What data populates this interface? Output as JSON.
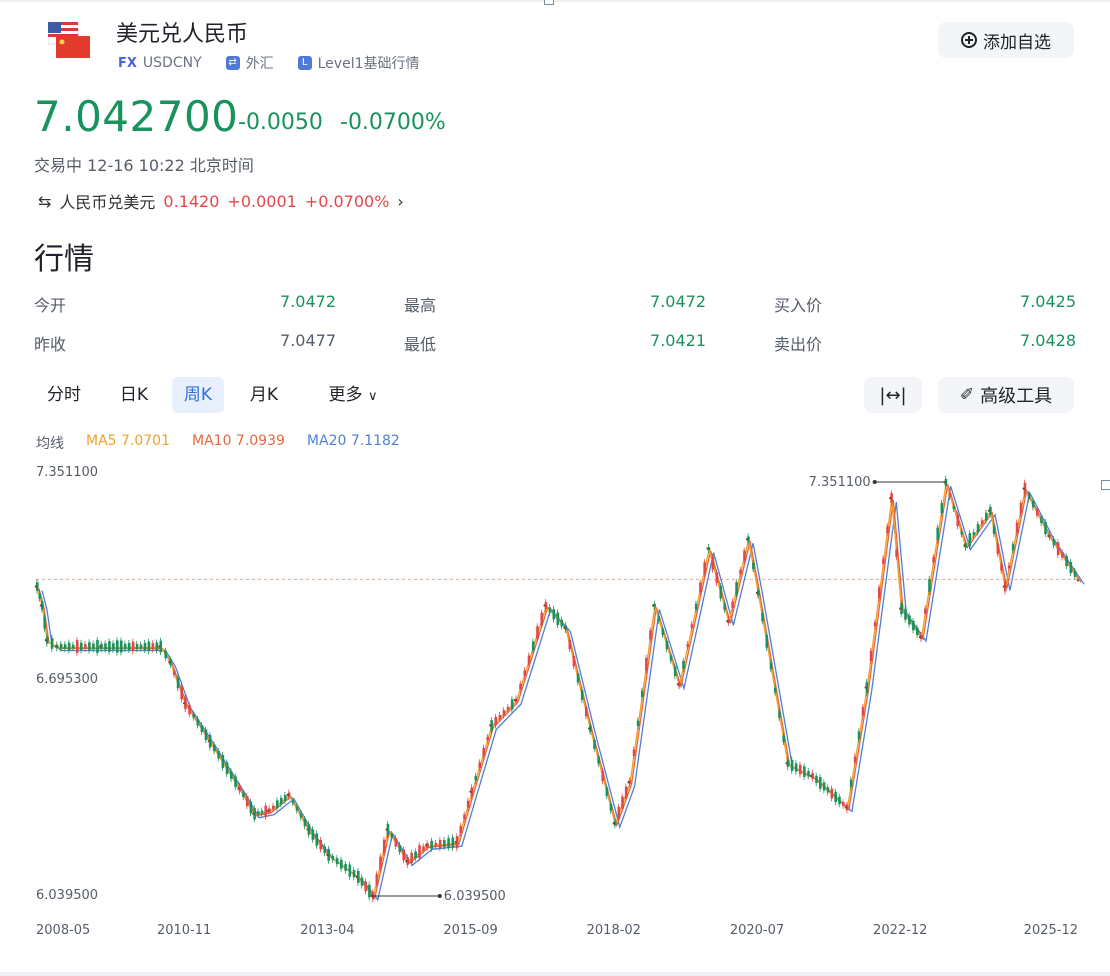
{
  "header": {
    "title": "美元兑人民币",
    "tag_fx": "FX",
    "symbol": "USDCNY",
    "tag_market": "外汇",
    "tag_level": "Level1基础行情",
    "add_watchlist_label": "添加自选"
  },
  "quote": {
    "price": "7.042700",
    "change": "-0.0050",
    "change_pct": "-0.0700%",
    "status": "交易中 12-16 10:22 北京时间",
    "reverse_label": "人民币兑美元",
    "reverse_price": "0.1420",
    "reverse_change": "+0.0001",
    "reverse_pct": "+0.0700%"
  },
  "section_title": "行情",
  "stats": [
    {
      "label": "今开",
      "value": "7.0472"
    },
    {
      "label": "最高",
      "value": "7.0472"
    },
    {
      "label": "买入价",
      "value": "7.0425"
    },
    {
      "label": "昨收",
      "value": "7.0477"
    },
    {
      "label": "最低",
      "value": "7.0421"
    },
    {
      "label": "卖出价",
      "value": "7.0428"
    }
  ],
  "tabs": [
    "分时",
    "日K",
    "周K",
    "月K",
    "更多"
  ],
  "active_tab": "周K",
  "tools": {
    "advanced": "高级工具"
  },
  "ma": {
    "label": "均线",
    "ma5": "MA5 7.0701",
    "ma10": "MA10 7.0939",
    "ma20": "MA20 7.1182"
  },
  "colors": {
    "up": "#e0484a",
    "down": "#19925d",
    "ma5": "#f0a12c",
    "ma10": "#e8673a",
    "ma20": "#4f7fd8"
  },
  "chart_data": {
    "type": "line",
    "title": "",
    "x_tick_labels": [
      "2008-05",
      "2010-11",
      "2013-04",
      "2015-09",
      "2018-02",
      "2020-07",
      "2022-12",
      "2025-12"
    ],
    "y_tick_labels": [
      "7.351100",
      "6.695300",
      "6.039500"
    ],
    "ylim": [
      6.0395,
      7.3511
    ],
    "max_label": "7.351100",
    "min_label": "6.039500",
    "reference_line": 7.0427,
    "series": [
      {
        "values": [
          {
            "x": "2008-05",
            "y": 7.02
          },
          {
            "x": "2008-06",
            "y": 6.96
          },
          {
            "x": "2008-07",
            "y": 6.85
          },
          {
            "x": "2008-09",
            "y": 6.83
          },
          {
            "x": "2009-06",
            "y": 6.83
          },
          {
            "x": "2010-06",
            "y": 6.83
          },
          {
            "x": "2010-08",
            "y": 6.78
          },
          {
            "x": "2010-11",
            "y": 6.65
          },
          {
            "x": "2011-04",
            "y": 6.53
          },
          {
            "x": "2011-10",
            "y": 6.38
          },
          {
            "x": "2012-01",
            "y": 6.3
          },
          {
            "x": "2012-04",
            "y": 6.31
          },
          {
            "x": "2012-08",
            "y": 6.36
          },
          {
            "x": "2012-12",
            "y": 6.25
          },
          {
            "x": "2013-04",
            "y": 6.17
          },
          {
            "x": "2013-10",
            "y": 6.1
          },
          {
            "x": "2014-01",
            "y": 6.04
          },
          {
            "x": "2014-04",
            "y": 6.25
          },
          {
            "x": "2014-08",
            "y": 6.15
          },
          {
            "x": "2014-12",
            "y": 6.2
          },
          {
            "x": "2015-06",
            "y": 6.21
          },
          {
            "x": "2015-09",
            "y": 6.37
          },
          {
            "x": "2016-01",
            "y": 6.58
          },
          {
            "x": "2016-06",
            "y": 6.66
          },
          {
            "x": "2016-12",
            "y": 6.96
          },
          {
            "x": "2017-04",
            "y": 6.89
          },
          {
            "x": "2017-09",
            "y": 6.57
          },
          {
            "x": "2018-02",
            "y": 6.27
          },
          {
            "x": "2018-05",
            "y": 6.4
          },
          {
            "x": "2018-10",
            "y": 6.96
          },
          {
            "x": "2019-03",
            "y": 6.71
          },
          {
            "x": "2019-09",
            "y": 7.14
          },
          {
            "x": "2020-01",
            "y": 6.91
          },
          {
            "x": "2020-05",
            "y": 7.17
          },
          {
            "x": "2020-07",
            "y": 7.0
          },
          {
            "x": "2021-01",
            "y": 6.46
          },
          {
            "x": "2021-06",
            "y": 6.42
          },
          {
            "x": "2022-01",
            "y": 6.32
          },
          {
            "x": "2022-05",
            "y": 6.7
          },
          {
            "x": "2022-10",
            "y": 7.3
          },
          {
            "x": "2022-12",
            "y": 6.95
          },
          {
            "x": "2023-04",
            "y": 6.86
          },
          {
            "x": "2023-09",
            "y": 7.35
          },
          {
            "x": "2024-01",
            "y": 7.15
          },
          {
            "x": "2024-06",
            "y": 7.26
          },
          {
            "x": "2024-09",
            "y": 7.02
          },
          {
            "x": "2025-01",
            "y": 7.33
          },
          {
            "x": "2025-06",
            "y": 7.18
          },
          {
            "x": "2025-12",
            "y": 7.04
          }
        ]
      }
    ]
  }
}
